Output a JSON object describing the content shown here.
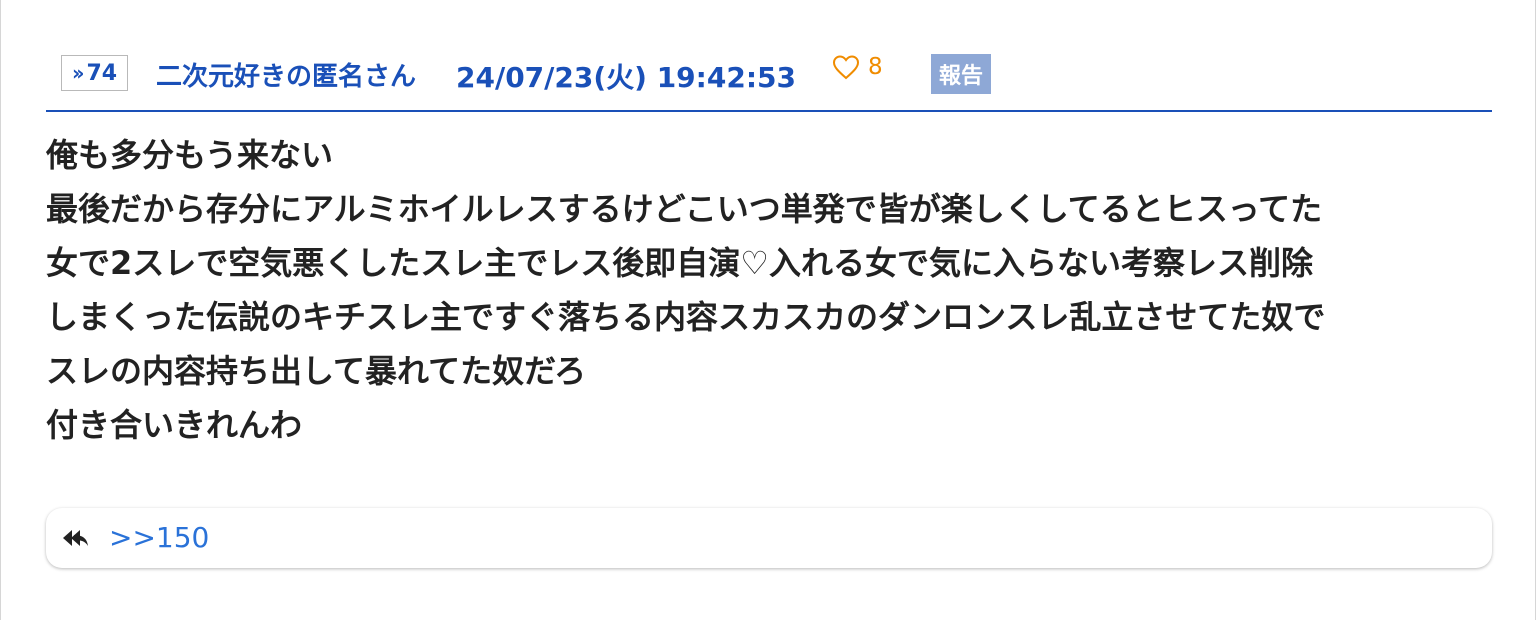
{
  "post": {
    "res_number": "74",
    "author": "二次元好きの匿名さん",
    "datetime": "24/07/23(火) 19:42:53",
    "like_count": "8",
    "report_label": "報告",
    "body_lines": [
      "俺も多分もう来ない",
      "最後だから存分にアルミホイルレスするけどこいつ単発で皆が楽しくしてるとヒスってた",
      "女で2スレで空気悪くしたスレ主でレス後即自演♡入れる女で気に入らない考察レス削除",
      "しまくった伝説のキチスレ主ですぐ落ちる内容スカスカのダンロンスレ乱立させてた奴で",
      "スレの内容持ち出して暴れてた奴だろ",
      "付き合いきれんわ"
    ]
  },
  "replies": {
    "items": [
      ">>150"
    ],
    "icon": "reply-arrows-icon"
  },
  "colors": {
    "accent": "#1a50b8",
    "like": "#f08c00",
    "report_bg": "#8ea8d6",
    "reply_link": "#2a72d8"
  }
}
